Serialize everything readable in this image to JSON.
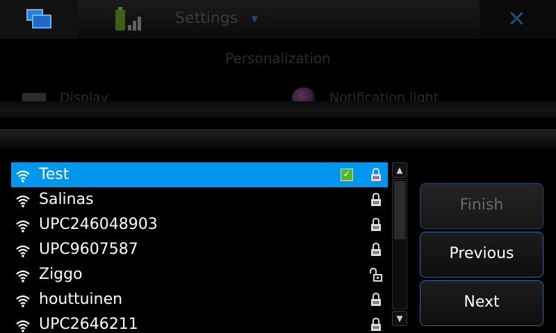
{
  "background": {
    "app_title": "Settings",
    "section": "Personalization",
    "items": [
      "Display",
      "Notification light"
    ]
  },
  "networks": [
    {
      "name": "Test",
      "selected": true,
      "connected": true,
      "locked": true
    },
    {
      "name": "Salinas",
      "selected": false,
      "connected": false,
      "locked": true
    },
    {
      "name": "UPC246048903",
      "selected": false,
      "connected": false,
      "locked": true
    },
    {
      "name": "UPC9607587",
      "selected": false,
      "connected": false,
      "locked": true
    },
    {
      "name": "Ziggo",
      "selected": false,
      "connected": false,
      "locked": false
    },
    {
      "name": "houttuinen",
      "selected": false,
      "connected": false,
      "locked": true
    },
    {
      "name": "UPC2646211",
      "selected": false,
      "connected": false,
      "locked": true
    }
  ],
  "buttons": {
    "finish": "Finish",
    "previous": "Previous",
    "next": "Next"
  },
  "icons": {
    "task_switcher": "task-switcher-icon",
    "battery": "battery-icon",
    "close": "close-icon",
    "wifi": "wifi-icon",
    "lock": "lock-icon",
    "unlock": "unlock-icon",
    "check": "check-icon"
  },
  "colors": {
    "selection": "#0096ed",
    "button_border": "#2a6ab0"
  }
}
